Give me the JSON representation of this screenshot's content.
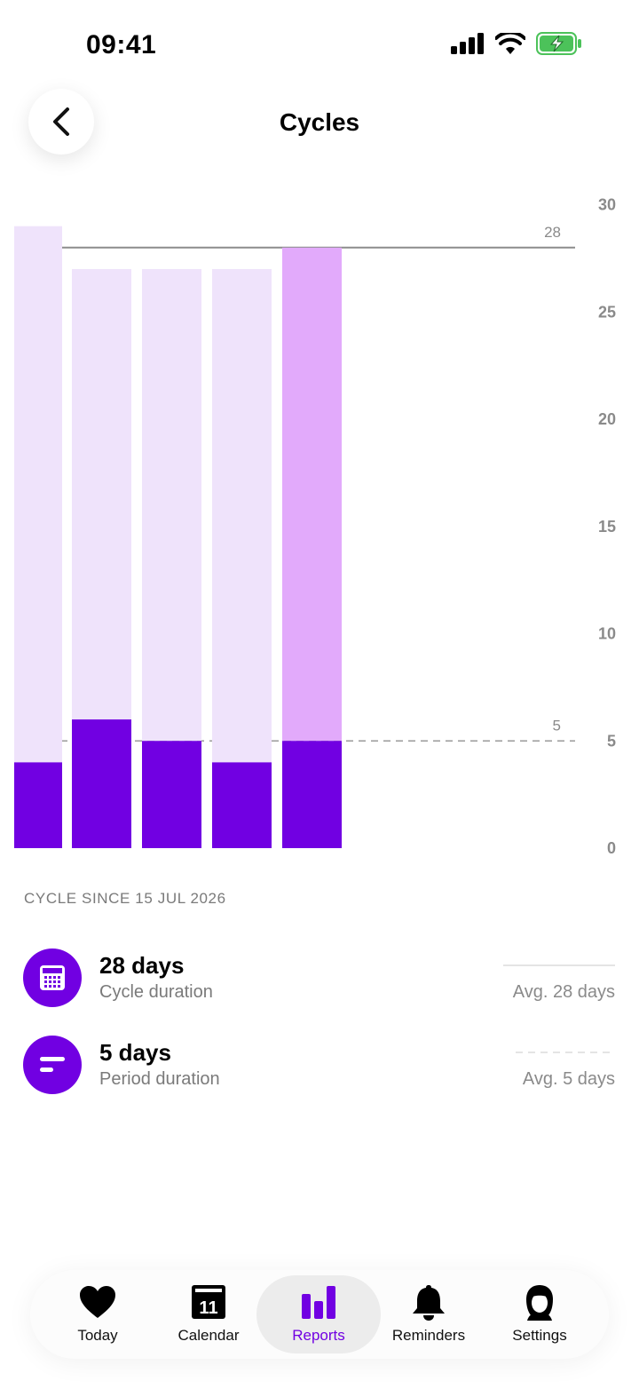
{
  "status": {
    "time": "09:41"
  },
  "header": {
    "title": "Cycles"
  },
  "chart_data": {
    "type": "bar",
    "categories": [
      "",
      "",
      "",
      "",
      ""
    ],
    "series": [
      {
        "values": [
          4,
          6,
          5,
          4,
          5
        ]
      },
      {
        "values": [
          29,
          27,
          27,
          27,
          28
        ]
      }
    ],
    "current_index": 4,
    "reference_lines": [
      {
        "value": 28,
        "label": "28",
        "style": "solid"
      },
      {
        "value": 5,
        "label": "5",
        "style": "dashed"
      }
    ],
    "ylim": [
      0,
      30
    ],
    "yticks": [
      "0",
      "5",
      "10",
      "15",
      "20",
      "25",
      "30"
    ],
    "y_axis_side": "right",
    "colors": {
      "period": "#7100e2",
      "cycle": "#efe3fb",
      "cycle_current": "#e2aafb"
    }
  },
  "summary": {
    "since_label": "CYCLE SINCE 15 JUL 2026",
    "cycle": {
      "value": "28 days",
      "label": "Cycle duration",
      "avg": "Avg. 28 days",
      "icon": "calendar-icon"
    },
    "period": {
      "value": "5 days",
      "label": "Period duration",
      "avg": "Avg. 5 days",
      "icon": "period-lines-icon"
    }
  },
  "tabs": [
    {
      "label": "Today",
      "icon": "heart-icon",
      "active": false
    },
    {
      "label": "Calendar",
      "icon": "calendar-day-icon",
      "day": "11",
      "active": false
    },
    {
      "label": "Reports",
      "icon": "bar-chart-icon",
      "active": true
    },
    {
      "label": "Reminders",
      "icon": "bell-icon",
      "active": false
    },
    {
      "label": "Settings",
      "icon": "person-icon",
      "active": false
    }
  ],
  "accent": "#7100e2"
}
